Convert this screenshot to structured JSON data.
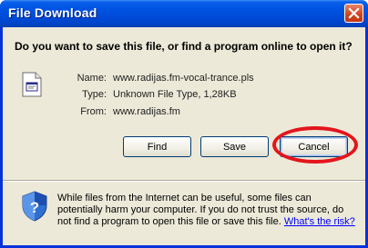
{
  "window": {
    "title": "File Download"
  },
  "dialog": {
    "question": "Do you want to save this file, or find a program online to open it?",
    "file_info": {
      "name_label": "Name:",
      "name_value": "www.radijas.fm-vocal-trance.pls",
      "type_label": "Type:",
      "type_value": "Unknown File Type, 1,28KB",
      "from_label": "From:",
      "from_value": "www.radijas.fm"
    },
    "buttons": {
      "find": "Find",
      "save": "Save",
      "cancel": "Cancel"
    },
    "warning": {
      "text": "While files from the Internet can be useful, some files can potentially harm your computer. If you do not trust the source, do not find a program to open this file or save this file.",
      "link": "What's the risk?"
    }
  },
  "icons": {
    "close": "close-icon",
    "file": "file-icon",
    "shield": "shield-icon"
  },
  "colors": {
    "titlebar": "#0054e3",
    "dialog_bg": "#ece9d8",
    "highlight": "#e4151c",
    "link": "#0000ff"
  }
}
